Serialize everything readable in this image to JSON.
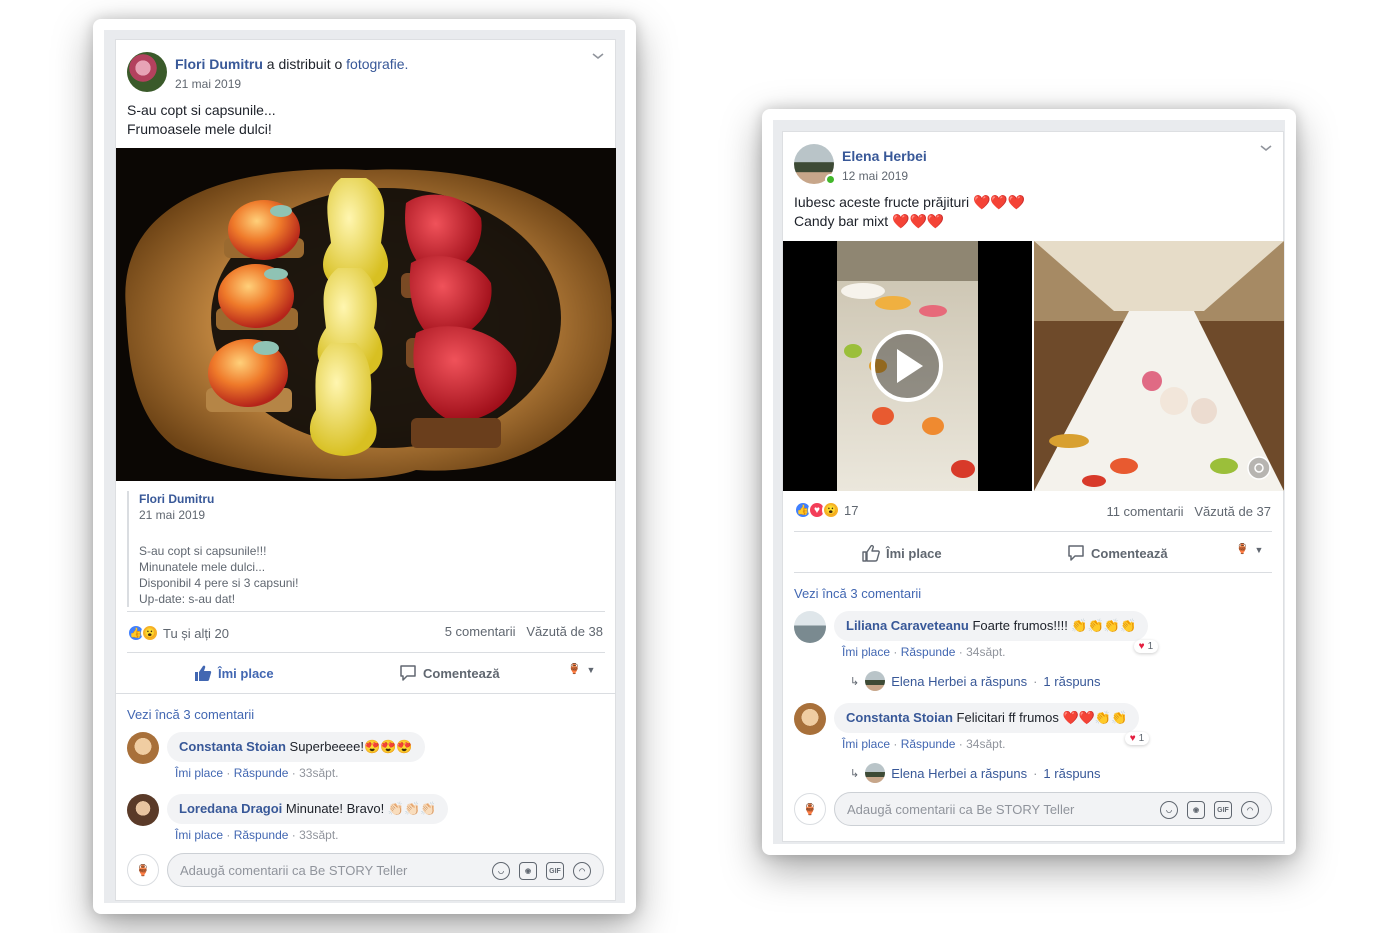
{
  "post1": {
    "author": "Flori Dumitru",
    "action_text": "a distribuit o",
    "action_link": "fotografie.",
    "date": "21 mai 2019",
    "message_lines": [
      "S-au copt si capsunile...",
      "Frumoasele mele dulci!"
    ],
    "shared": {
      "author": "Flori Dumitru",
      "date": "21 mai 2019",
      "lines": [
        "S-au copt si capsunile!!!",
        "Minunatele mele dulci...",
        "Disponibil 4 pere si 3 capsuni!",
        "Up-date: s-au dat!"
      ]
    },
    "reactions_text": "Tu și alți 20",
    "comments_count": "5 comentarii",
    "views": "Văzută de 38",
    "like_label": "Îmi place",
    "comment_label": "Comentează",
    "more_comments": "Vezi încă 3 comentarii",
    "comments": [
      {
        "name": "Constanta Stoian",
        "text": "Superbeeee!😍😍😍",
        "like": "Îmi place",
        "reply": "Răspunde",
        "time": "33săpt."
      },
      {
        "name": "Loredana Dragoi",
        "text": "Minunate! Bravo! 👏🏻👏🏻👏🏻",
        "like": "Îmi place",
        "reply": "Răspunde",
        "time": "33săpt."
      }
    ],
    "composer_placeholder": "Adaugă comentarii ca Be STORY Teller"
  },
  "post2": {
    "author": "Elena Herbei",
    "date": "12 mai 2019",
    "message_lines": [
      "Iubesc aceste fructe prăjituri ❤️❤️❤️",
      "Candy bar mixt ❤️❤️❤️"
    ],
    "reactions_count": "17",
    "comments_count": "11 comentarii",
    "views": "Văzută de 37",
    "like_label": "Îmi place",
    "comment_label": "Comentează",
    "more_comments": "Vezi încă 3 comentarii",
    "comments": [
      {
        "name": "Liliana Caraveteanu",
        "text": "Foarte frumos!!!! 👏👏👏👏",
        "like": "Îmi place",
        "reply": "Răspunde",
        "time": "34săpt.",
        "react_count": "1",
        "reply_author": "Elena Herbei a răspuns",
        "reply_count": "1 răspuns"
      },
      {
        "name": "Constanta Stoian",
        "text": "Felicitari ff frumos ❤️❤️👏👏",
        "like": "Îmi place",
        "reply": "Răspunde",
        "time": "34săpt.",
        "react_count": "1",
        "reply_author": "Elena Herbei a răspuns",
        "reply_count": "1 răspuns"
      }
    ],
    "composer_placeholder": "Adaugă comentarii ca Be STORY Teller"
  },
  "colors": {
    "link": "#385898",
    "accent": "#4267b2",
    "muted": "#606770",
    "bg": "#e9ebee"
  },
  "icons": [
    "chevron-down-icon",
    "like-icon",
    "comment-icon",
    "play-icon",
    "emoji-icon",
    "camera-icon",
    "gif-icon",
    "sticker-icon",
    "reply-arrow-icon"
  ]
}
